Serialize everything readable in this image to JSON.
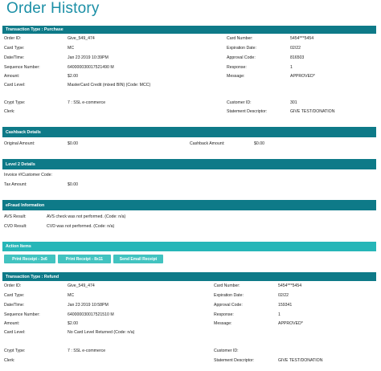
{
  "page_title": "Order History",
  "colors": {
    "accent": "#1b8fa6",
    "header_dark": "#0e7a88",
    "header_light": "#26b6b8",
    "button": "#41c3c0"
  },
  "purchase": {
    "header": "Transaction Type : Purchase",
    "order_id_label": "Order ID:",
    "order_id": "Give_549_474",
    "card_type_label": "Card Type:",
    "card_type": "MC",
    "datetime_label": "Date/Time:",
    "datetime": "Jan 23 2019 10:39PM",
    "sequence_label": "Sequence Number:",
    "sequence": "640000030017521490 M",
    "amount_label": "Amount:",
    "amount": "$2.00",
    "card_level_label": "Card Level:",
    "card_level": "MasterCard Credit (mixed BIN) (Code: MCC)",
    "crypt_label": "Crypt Type:",
    "crypt": "7 : SSL e-commerce",
    "clerk_label": "Clerk:",
    "card_number_label": "Card Number:",
    "card_number": "5454***5454",
    "expiration_label": "Expiration Date:",
    "expiration": "02/22",
    "approval_label": "Approval Code:",
    "approval": "816503",
    "response_label": "Response:",
    "response": "1",
    "message_label": "Message:",
    "message": "APPROVED*",
    "customer_id_label": "Customer ID:",
    "customer_id": "301",
    "statement_label": "Statement Descriptor:",
    "statement": "GIVE TEST/DONATION"
  },
  "cashback": {
    "header": "Cashback Details",
    "original_label": "Original Amount:",
    "original": "$0.00",
    "cashback_label": "Cashback Amount:",
    "cashback": "$0.00"
  },
  "level2": {
    "header": "Level 2 Details",
    "invoice_label": "Invoice #/Customer Code:",
    "tax_label": "Tax Amount:",
    "tax": "$0.00"
  },
  "efraud": {
    "header": "eFraud Information",
    "avs_label": "AVS Result:",
    "avs": "AVS check was not performed. (Code: n/a)",
    "cvd_label": "CVD Result:",
    "cvd": "CVD was not performed. (Code: n/a)"
  },
  "actions": {
    "header": "Action Items",
    "print_3x6": "Print Receipt - 3x6",
    "print_8x11": "Print Receipt - 8x11",
    "send_email": "Send Email Receipt"
  },
  "refund": {
    "header": "Transaction Type : Refund",
    "order_id_label": "Order ID:",
    "order_id": "Give_549_474",
    "card_type_label": "Card Type:",
    "card_type": "MC",
    "datetime_label": "Date/Time:",
    "datetime": "Jan 23 2019 10:58PM",
    "sequence_label": "Sequence Number:",
    "sequence": "640000030017521510 M",
    "amount_label": "Amount:",
    "amount": "$2.00",
    "card_level_label": "Card Level:",
    "card_level": "No Card Level Returned (Code: n/a)",
    "crypt_label": "Crypt Type:",
    "crypt": "7 : SSL e-commerce",
    "clerk_label": "Clerk:",
    "card_number_label": "Card Number:",
    "card_number": "5454***5454",
    "expiration_label": "Expiration Date:",
    "expiration": "02/22",
    "approval_label": "Approval Code:",
    "approval": "159341",
    "response_label": "Response:",
    "response": "1",
    "message_label": "Message:",
    "message": "APPROVED*",
    "customer_id_label": "Customer ID:",
    "statement_label": "Statement Descriptor:",
    "statement": "GIVE TEST/DONATION"
  }
}
